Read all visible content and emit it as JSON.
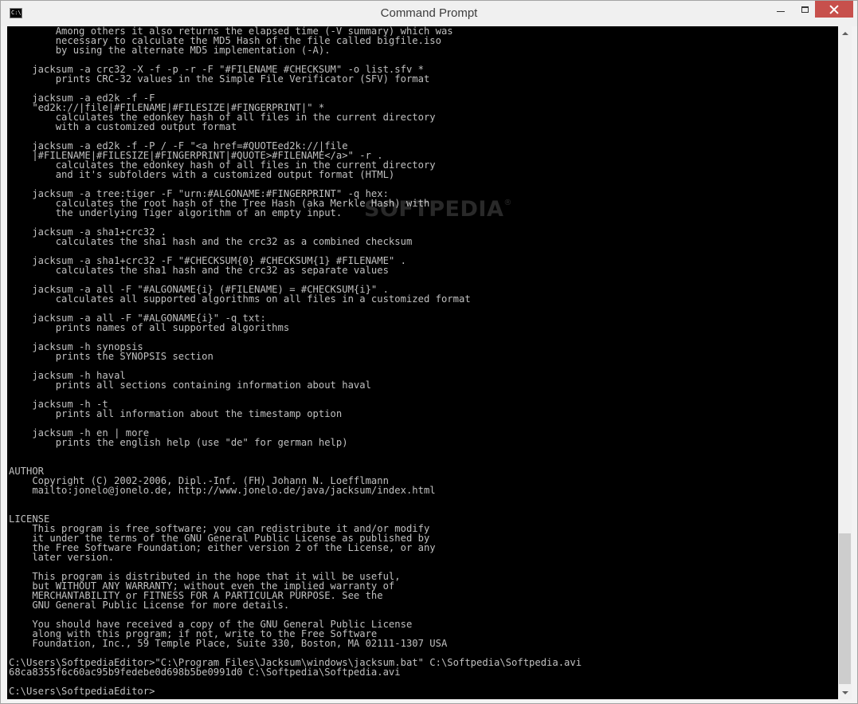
{
  "window": {
    "title": "Command Prompt",
    "icon_text": "C:\\",
    "minimize_icon": "minimize-icon",
    "maximize_icon": "maximize-icon",
    "close_icon": "close-icon",
    "close_color": "#c7504c"
  },
  "console": {
    "background": "#000000",
    "foreground": "#c0c0c0",
    "text": "        Among others it also returns the elapsed time (-V summary) which was\n        necessary to calculate the MD5 Hash of the file called bigfile.iso\n        by using the alternate MD5 implementation (-A).\n\n    jacksum -a crc32 -X -f -p -r -F \"#FILENAME #CHECKSUM\" -o list.sfv *\n        prints CRC-32 values in the Simple File Verificator (SFV) format\n\n    jacksum -a ed2k -f -F\n    \"ed2k://|file|#FILENAME|#FILESIZE|#FINGERPRINT|\" *\n        calculates the edonkey hash of all files in the current directory\n        with a customized output format\n\n    jacksum -a ed2k -f -P / -F \"<a href=#QUOTEed2k://|file\n    |#FILENAME|#FILESIZE|#FINGERPRINT|#QUOTE>#FILENAME</a>\" -r .\n        calculates the edonkey hash of all files in the current directory\n        and it's subfolders with a customized output format (HTML)\n\n    jacksum -a tree:tiger -F \"urn:#ALGONAME:#FINGERPRINT\" -q hex:\n        calculates the root hash of the Tree Hash (aka Merkle Hash) with\n        the underlying Tiger algorithm of an empty input.\n\n    jacksum -a sha1+crc32 .\n        calculates the sha1 hash and the crc32 as a combined checksum\n\n    jacksum -a sha1+crc32 -F \"#CHECKSUM{0} #CHECKSUM{1} #FILENAME\" .\n        calculates the sha1 hash and the crc32 as separate values\n\n    jacksum -a all -F \"#ALGONAME{i} (#FILENAME) = #CHECKSUM{i}\" .\n        calculates all supported algorithms on all files in a customized format\n\n    jacksum -a all -F \"#ALGONAME{i}\" -q txt:\n        prints names of all supported algorithms\n\n    jacksum -h synopsis\n        prints the SYNOPSIS section\n\n    jacksum -h haval\n        prints all sections containing information about haval\n\n    jacksum -h -t\n        prints all information about the timestamp option\n\n    jacksum -h en | more\n        prints the english help (use \"de\" for german help)\n\n\nAUTHOR\n    Copyright (C) 2002-2006, Dipl.-Inf. (FH) Johann N. Loefflmann\n    mailto:jonelo@jonelo.de, http://www.jonelo.de/java/jacksum/index.html\n\n\nLICENSE\n    This program is free software; you can redistribute it and/or modify\n    it under the terms of the GNU General Public License as published by\n    the Free Software Foundation; either version 2 of the License, or any\n    later version.\n\n    This program is distributed in the hope that it will be useful,\n    but WITHOUT ANY WARRANTY; without even the implied warranty of\n    MERCHANTABILITY or FITNESS FOR A PARTICULAR PURPOSE. See the\n    GNU General Public License for more details.\n\n    You should have received a copy of the GNU General Public License\n    along with this program; if not, write to the Free Software\n    Foundation, Inc., 59 Temple Place, Suite 330, Boston, MA 02111-1307 USA\n\nC:\\Users\\SoftpediaEditor>\"C:\\Program Files\\Jacksum\\windows\\jacksum.bat\" C:\\Softpedia\\Softpedia.avi\n68ca8355f6c60ac95b9fedebe0d698b5be0991d0 C:\\Softpedia\\Softpedia.avi\n\nC:\\Users\\SoftpediaEditor>"
  },
  "watermark": {
    "text": "SOFTPEDIA",
    "mark": "®"
  },
  "scrollbar": {
    "up_icon": "scroll-up-arrow-icon",
    "down_icon": "scroll-down-arrow-icon",
    "position_fraction": 0.78
  }
}
